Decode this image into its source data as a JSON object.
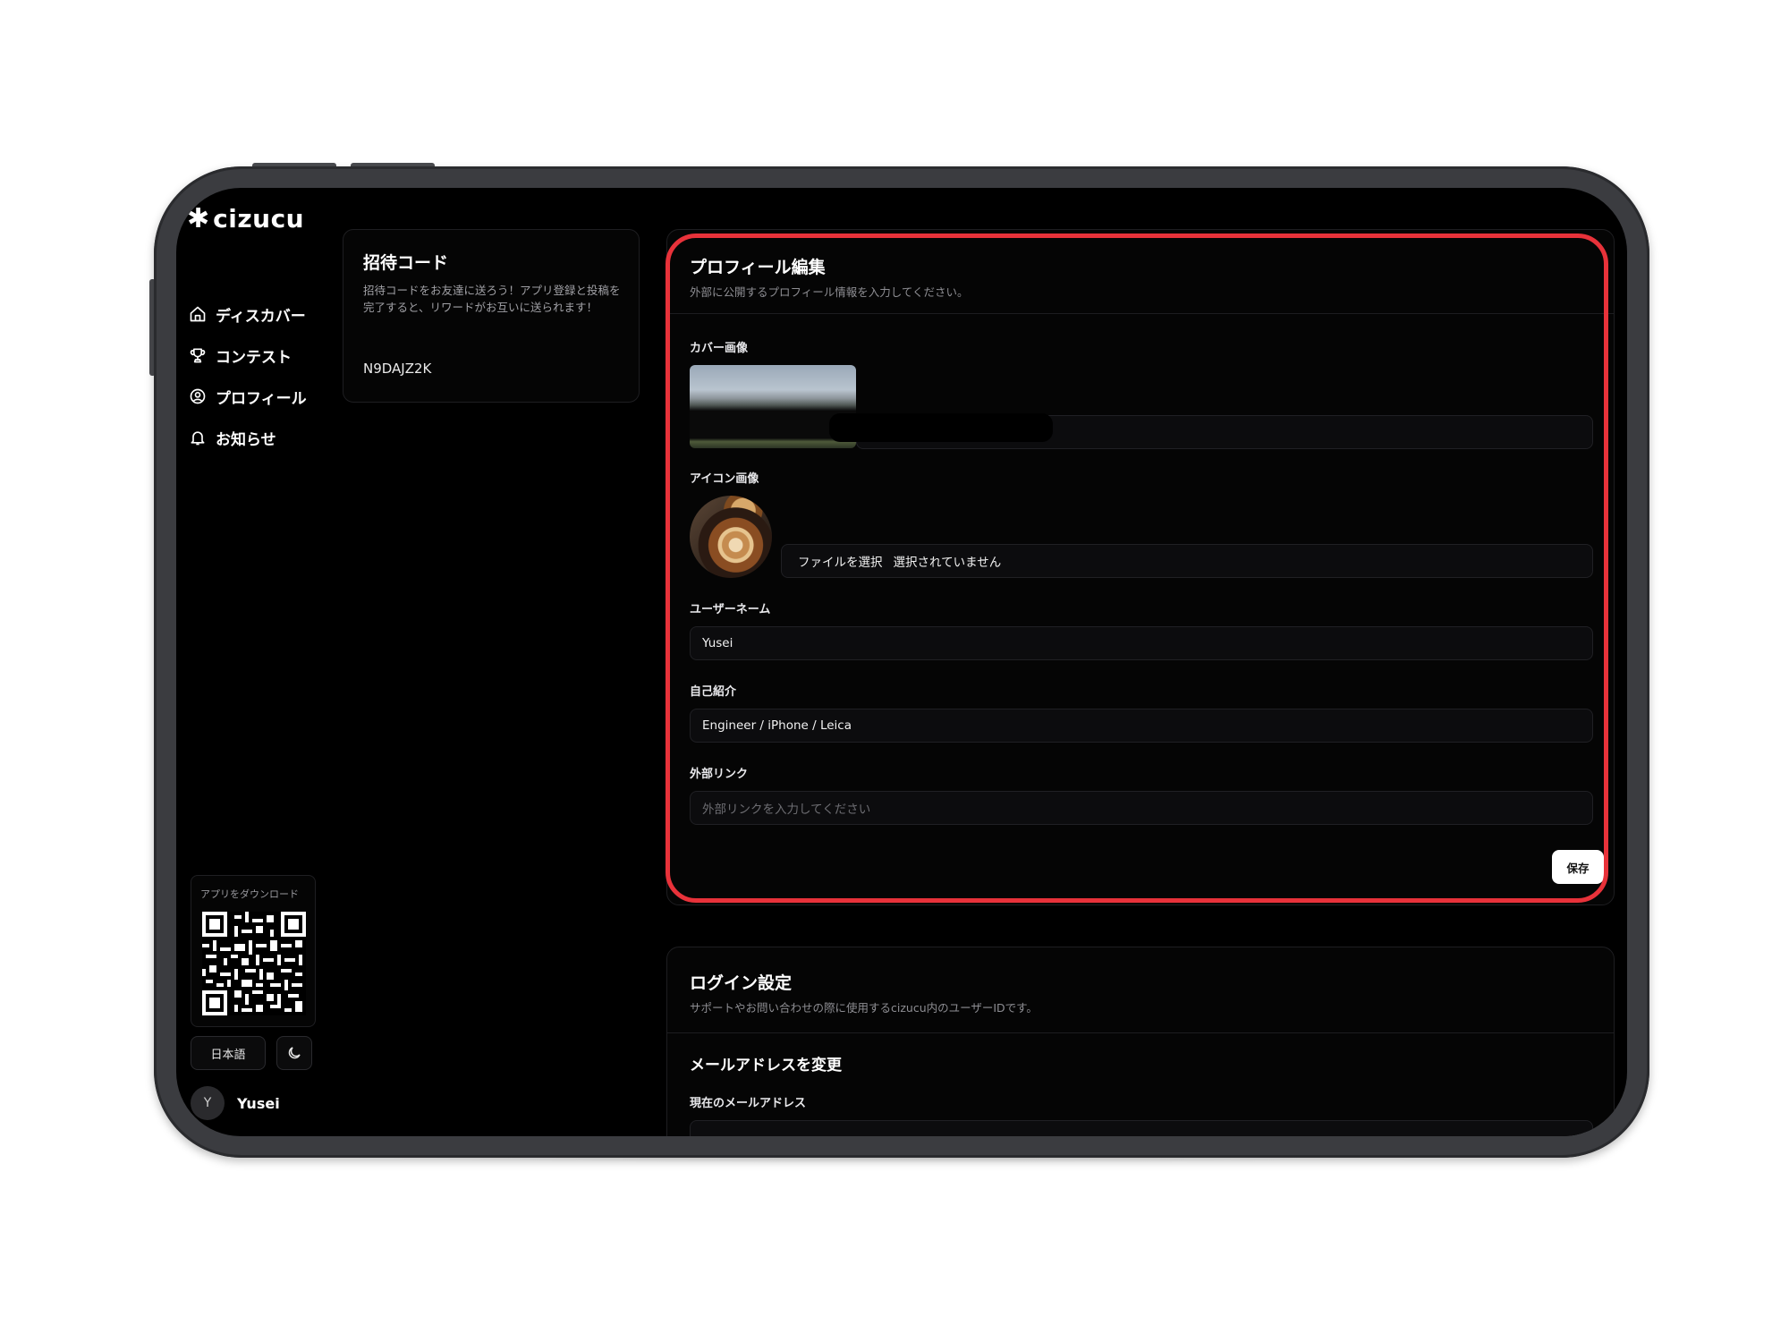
{
  "app": {
    "logo_mark": "✱",
    "logo_text": "cizucu"
  },
  "sidebar": {
    "nav": [
      {
        "label": "ディスカバー",
        "icon": "home-icon"
      },
      {
        "label": "コンテスト",
        "icon": "trophy-icon"
      },
      {
        "label": "プロフィール",
        "icon": "user-circle-icon"
      },
      {
        "label": "お知らせ",
        "icon": "bell-icon"
      }
    ],
    "qr_title": "アプリをダウンロード",
    "language": "日本語",
    "user": {
      "initial": "Y",
      "name": "Yusei"
    }
  },
  "invite": {
    "title": "招待コード",
    "description": "招待コードをお友達に送ろう！アプリ登録と投稿を完了すると、リワードがお互いに送られます！",
    "code": "N9DAJZ2K"
  },
  "profile": {
    "title": "プロフィール編集",
    "subtitle": "外部に公開するプロフィール情報を入力してください。",
    "cover_label": "カバー画像",
    "icon_label": "アイコン画像",
    "file_button": "ファイルを選択",
    "file_status": "選択されていません",
    "username_label": "ユーザーネーム",
    "username_value": "Yusei",
    "bio_label": "自己紹介",
    "bio_value": "Engineer / iPhone / Leica",
    "link_label": "外部リンク",
    "link_placeholder": "外部リンクを入力してください",
    "save_label": "保存"
  },
  "login": {
    "title": "ログイン設定",
    "subtitle": "サポートやお問い合わせの際に使用するcizucu内のユーザーIDです。",
    "email_title": "メールアドレスを変更",
    "current_email_label": "現在のメールアドレス"
  },
  "colors": {
    "highlight": "#e8323a",
    "background": "#000000",
    "frame": "#3b3c40"
  }
}
